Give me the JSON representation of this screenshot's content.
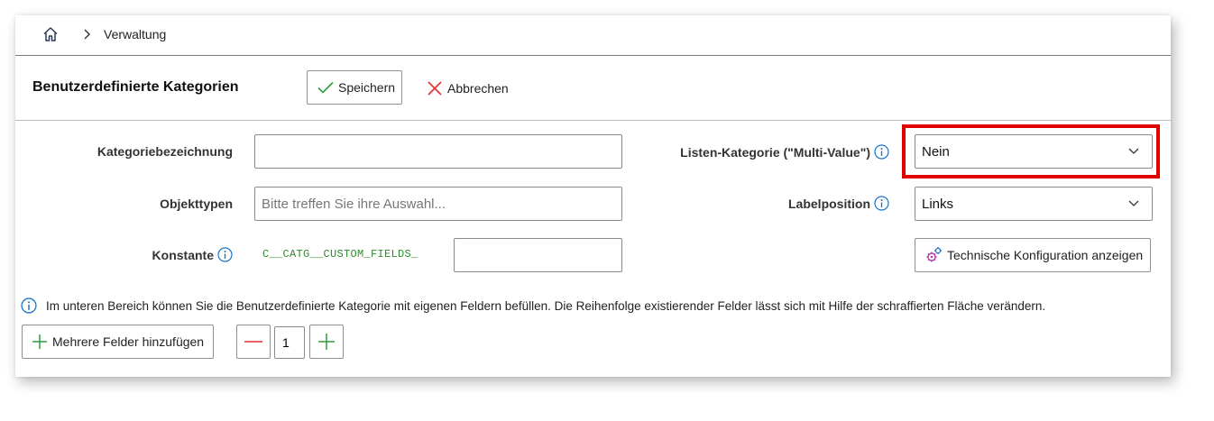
{
  "breadcrumb": {
    "home_icon": "home-icon",
    "separator_icon": "chevron-right-icon",
    "current": "Verwaltung"
  },
  "header": {
    "title": "Benutzerdefinierte Kategorien",
    "save_label": "Speichern",
    "cancel_label": "Abbrechen"
  },
  "form": {
    "category_name": {
      "label": "Kategoriebezeichnung",
      "value": ""
    },
    "object_types": {
      "label": "Objekttypen",
      "value": "",
      "placeholder": "Bitte treffen Sie ihre Auswahl..."
    },
    "constant": {
      "label": "Konstante",
      "prefix": "C__CATG__CUSTOM_FIELDS_",
      "value": ""
    },
    "multi_value": {
      "label": "Listen-Kategorie (\"Multi-Value\")",
      "value": "Nein"
    },
    "label_position": {
      "label": "Labelposition",
      "value": "Links"
    },
    "tech_config_label": "Technische Konfiguration anzeigen"
  },
  "footer": {
    "info_text": "Im unteren Bereich können Sie die Benutzerdefinierte Kategorie mit eigenen Feldern befüllen. Die Reihenfolge existierender Felder lässt sich mit Hilfe der schraffierten Fläche verändern.",
    "add_fields_label": "Mehrere Felder hinzufügen",
    "field_count": "1"
  },
  "colors": {
    "accent_blue": "#1a73c9",
    "save_green": "#2e9e3e",
    "cancel_red": "#e03030",
    "highlight_red": "#e00000"
  }
}
